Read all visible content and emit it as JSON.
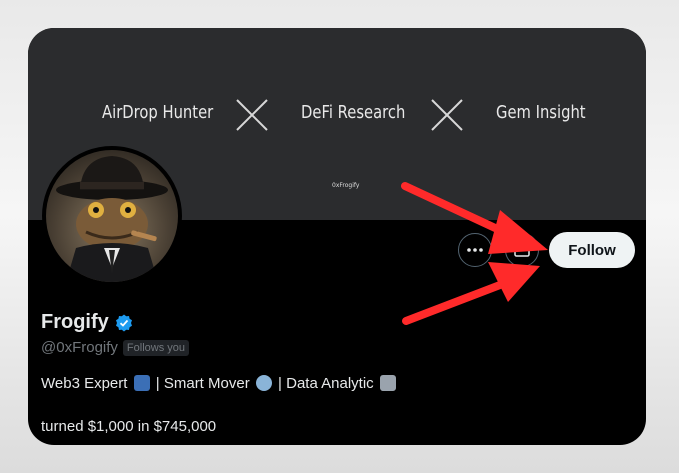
{
  "banner": {
    "words": [
      "AirDrop Hunter",
      "DeFi Research",
      "Gem Insight"
    ],
    "tag": "0xFrogify"
  },
  "profile": {
    "display_name": "Frogify",
    "handle": "@0xFrogify",
    "follows_you": "Follows you",
    "bio_parts": [
      "Web3 Expert",
      " | Smart Mover",
      " | Data Analytic"
    ],
    "bio_line2": "turned $1,000 in $745,000"
  },
  "actions": {
    "more_icon": "more-horizontal-icon",
    "message_icon": "envelope-icon",
    "follow_label": "Follow"
  },
  "colors": {
    "card_bg": "#000000",
    "banner_bg": "#2b2c2e",
    "verified": "#1d9bf0",
    "arrow": "#ff2a2a"
  }
}
